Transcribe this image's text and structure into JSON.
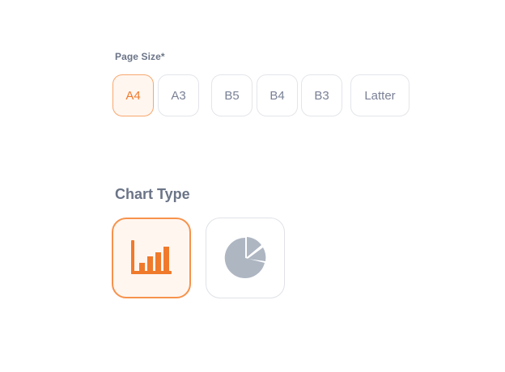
{
  "page_size": {
    "label": "Page Size*",
    "options": [
      "A4",
      "A3",
      "B5",
      "B4",
      "B3",
      "Latter"
    ],
    "selected": "A4"
  },
  "chart_type": {
    "label": "Chart Type",
    "options": [
      {
        "icon": "bar-chart-icon",
        "selected": true
      },
      {
        "icon": "pie-chart-icon",
        "selected": false
      }
    ]
  },
  "colors": {
    "accent": "#f07a2b",
    "accent_border": "#f8a76d",
    "accent_bg": "#fff6f0",
    "text_muted": "#6b7487",
    "icon_gray": "#aeb6c2",
    "border": "#e3e5ea"
  }
}
